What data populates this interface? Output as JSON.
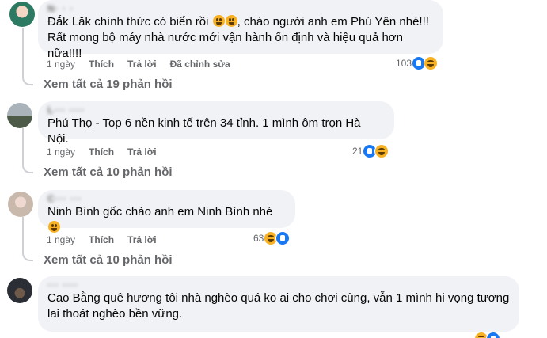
{
  "comments": [
    {
      "author": "N· · ·",
      "text": "Đắk Lăk chính thức có biển rồi ",
      "text_after_emoji": ", chào người anh em Phú Yên nhé!!!",
      "text_line2": "Rất mong bộ máy nhà nước mới vận hành ổn định và hiệu quả hơn nữa!!!!",
      "time": "1 ngày",
      "like": "Thích",
      "reply": "Trả lời",
      "edited": "Đã chỉnh sửa",
      "reaction_count": "103",
      "reactions": [
        "like-icon",
        "haha-icon"
      ],
      "view_replies": "Xem tất cả 19 phản hồi"
    },
    {
      "author": "L··· ····",
      "text": "Phú Thọ - Top 6 nền kinh tế trên 34 tỉnh. 1 mình ôm trọn Hà Nội.",
      "time": "1 ngày",
      "like": "Thích",
      "reply": "Trả lời",
      "reaction_count": "21",
      "reactions": [
        "like-icon",
        "haha-icon"
      ],
      "view_replies": "Xem tất cả 10 phản hồi"
    },
    {
      "author": "C··· ···",
      "text": "Ninh Bình gốc chào anh em Ninh Bình nhé ",
      "time": "1 ngày",
      "like": "Thích",
      "reply": "Trả lời",
      "reaction_count": "63",
      "reactions": [
        "haha-icon",
        "like-icon"
      ],
      "view_replies": "Xem tất cả 10 phản hồi"
    },
    {
      "author": "··· ····",
      "text": "Cao Bằng quê hương tôi nhà nghèo quá ko ai cho chơi cùng, vẫn 1 mình hi vọng tương",
      "text_line2": "lai thoát nghèo bền vững.",
      "reactions": [
        "haha-icon",
        "like-icon"
      ]
    }
  ],
  "colors": {
    "bubble": "#f0f2f5",
    "meta": "#65676b",
    "like": "#1877f2",
    "haha": "#f7b125"
  }
}
